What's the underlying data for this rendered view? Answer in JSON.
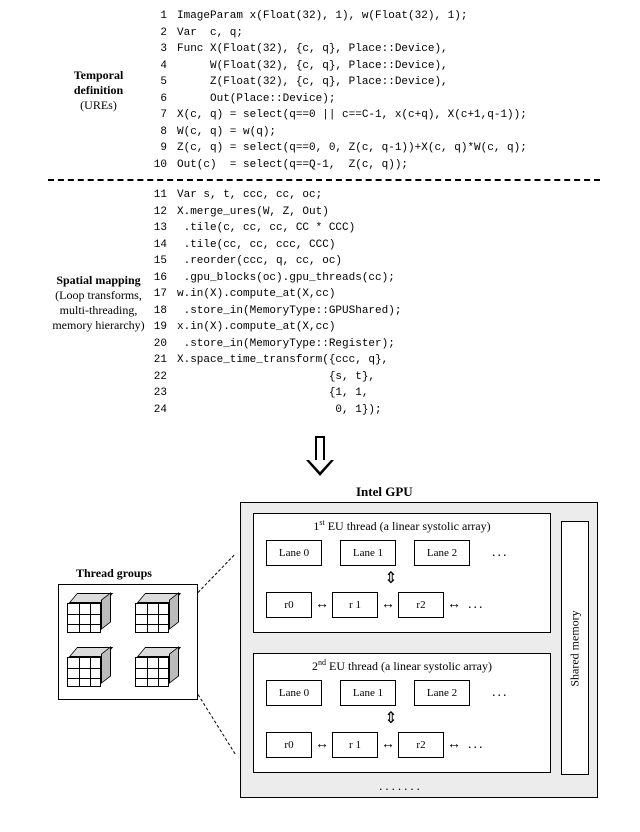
{
  "labels": {
    "temporal_title": "Temporal definition",
    "temporal_sub": "(UREs)",
    "spatial_title": "Spatial mapping",
    "spatial_sub": "(Loop transforms, multi-threading, memory hierarchy)",
    "gpu_title": "Intel GPU",
    "eu1_html": "1<sup>st</sup> EU thread (a linear systolic array)",
    "eu2_html": "2<sup>nd</sup> EU thread (a linear systolic array)",
    "tg_label": "Thread groups",
    "shared_mem": "Shared memory",
    "lanes": [
      "Lane 0",
      "Lane 1",
      "Lane 2"
    ],
    "regs": [
      "r0",
      "r 1",
      "r2"
    ],
    "ellipsis": "...",
    "dots_row": "......."
  },
  "code_temporal": [
    {
      "n": "1",
      "t": "ImageParam x(Float(32), 1), w(Float(32), 1);"
    },
    {
      "n": "2",
      "t": "Var  c, q;"
    },
    {
      "n": "3",
      "t": "Func X(Float(32), {c, q}, Place::Device),"
    },
    {
      "n": "4",
      "t": "     W(Float(32), {c, q}, Place::Device),"
    },
    {
      "n": "5",
      "t": "     Z(Float(32), {c, q}, Place::Device),"
    },
    {
      "n": "6",
      "t": "     Out(Place::Device);"
    },
    {
      "n": "7",
      "t": "X(c, q) = select(q==0 || c==C-1, x(c+q), X(c+1,q-1));"
    },
    {
      "n": "8",
      "t": "W(c, q) = w(q);"
    },
    {
      "n": "9",
      "t": "Z(c, q) = select(q==0, 0, Z(c, q-1))+X(c, q)*W(c, q);"
    },
    {
      "n": "10",
      "t": "Out(c)  = select(q==Q-1,  Z(c, q));"
    }
  ],
  "code_spatial": [
    {
      "n": "11",
      "t": "Var s, t, ccc, cc, oc;"
    },
    {
      "n": "12",
      "t": "X.merge_ures(W, Z, Out)"
    },
    {
      "n": "13",
      "t": " .tile(c, cc, cc, CC * CCC)"
    },
    {
      "n": "14",
      "t": " .tile(cc, cc, ccc, CCC)"
    },
    {
      "n": "15",
      "t": " .reorder(ccc, q, cc, oc)"
    },
    {
      "n": "16",
      "t": " .gpu_blocks(oc).gpu_threads(cc);"
    },
    {
      "n": "17",
      "t": "w.in(X).compute_at(X,cc)"
    },
    {
      "n": "18",
      "t": " .store_in(MemoryType::GPUShared);"
    },
    {
      "n": "19",
      "t": "x.in(X).compute_at(X,cc)"
    },
    {
      "n": "20",
      "t": " .store_in(MemoryType::Register);"
    },
    {
      "n": "21",
      "t": "X.space_time_transform({ccc, q},"
    },
    {
      "n": "22",
      "t": "                       {s, t},"
    },
    {
      "n": "23",
      "t": "                       {1, 1,"
    },
    {
      "n": "24",
      "t": "                        0, 1});"
    }
  ]
}
